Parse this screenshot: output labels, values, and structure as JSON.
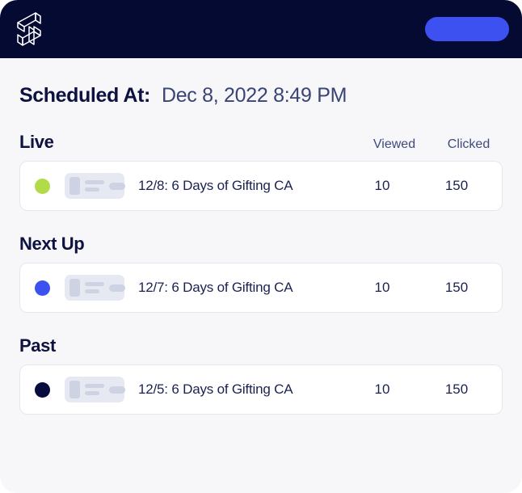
{
  "header": {
    "logo_icon": "lightning-bolt-logo-icon",
    "background_color": "#050a33",
    "action_button": {
      "label": "",
      "color": "#3c51f0"
    }
  },
  "scheduled": {
    "label": "Scheduled At:",
    "value": "Dec 8, 2022 8:49 PM"
  },
  "columns": {
    "viewed": "Viewed",
    "clicked": "Clicked"
  },
  "sections": [
    {
      "title": "Live",
      "show_columns": true,
      "rows": [
        {
          "status_color": "#b2db4a",
          "status_name": "live",
          "title": "12/8: 6 Days of Gifting CA",
          "viewed": "10",
          "clicked": "150"
        }
      ]
    },
    {
      "title": "Next Up",
      "show_columns": false,
      "rows": [
        {
          "status_color": "#3c51f0",
          "status_name": "next-up",
          "title": "12/7: 6 Days of Gifting CA",
          "viewed": "10",
          "clicked": "150"
        }
      ]
    },
    {
      "title": "Past",
      "show_columns": false,
      "rows": [
        {
          "status_color": "#080b3d",
          "status_name": "past",
          "title": "12/5: 6 Days of Gifting CA",
          "viewed": "10",
          "clicked": "150"
        }
      ]
    }
  ]
}
